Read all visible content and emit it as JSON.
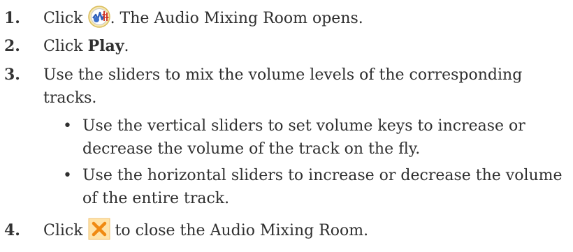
{
  "steps": [
    {
      "number": "1.",
      "prefix": "Click ",
      "icon": "audio-mixing-room-icon",
      "suffix": ". The Audio Mixing Room opens."
    },
    {
      "number": "2.",
      "prefix": "Click ",
      "bold": "Play",
      "suffix": "."
    },
    {
      "number": "3.",
      "line1": "Use the sliders to mix the volume levels of the corresponding",
      "line2": "tracks.",
      "bullets": [
        {
          "line1": "Use the vertical sliders to set volume keys to increase or",
          "line2": "decrease the volume of the track on the fly."
        },
        {
          "line1": "Use the horizontal sliders to increase or decrease the volume",
          "line2": "of the entire track."
        }
      ]
    },
    {
      "number": "4.",
      "prefix": "Click ",
      "icon": "close-icon",
      "suffix": " to close the Audio Mixing Room."
    }
  ],
  "bullet_glyph": "•",
  "colors": {
    "text": "#2f2f2f",
    "mixer_icon_ring": "#e8d28a",
    "mixer_icon_face": "#3b6fc9",
    "close_icon_bg": "#ffd98a",
    "close_icon_x": "#f08a12"
  }
}
